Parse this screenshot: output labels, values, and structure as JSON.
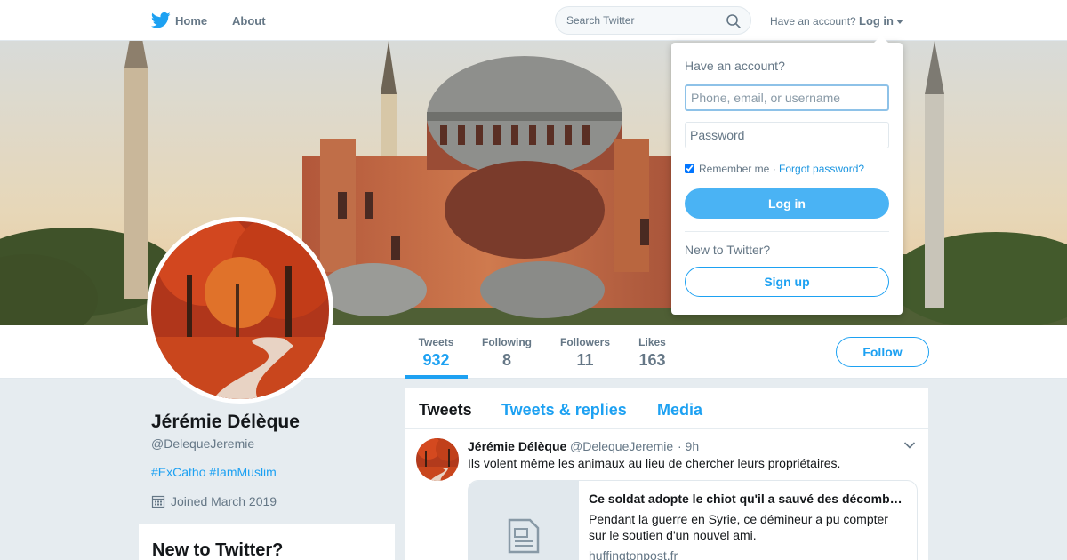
{
  "nav": {
    "home_label": "Home",
    "about_label": "About",
    "search_placeholder": "Search Twitter",
    "have_account": "Have an account?",
    "login_label": "Log in"
  },
  "profile": {
    "name": "Jérémie Délèque",
    "handle": "@DelequeJeremie",
    "bio": "#ExCatho #IamMuslim",
    "joined": "Joined March 2019"
  },
  "stats": [
    {
      "label": "Tweets",
      "value": "932"
    },
    {
      "label": "Following",
      "value": "8"
    },
    {
      "label": "Followers",
      "value": "11"
    },
    {
      "label": "Likes",
      "value": "163"
    }
  ],
  "follow_label": "Follow",
  "sidebar": {
    "signup_heading": "New to Twitter?"
  },
  "timeline": {
    "tabs": [
      "Tweets",
      "Tweets & replies",
      "Media"
    ],
    "tweet": {
      "name": "Jérémie Délèque",
      "handle": "@DelequeJeremie",
      "time": "· 9h",
      "text": "Ils volent même les animaux au lieu de chercher leurs propriétaires.",
      "card": {
        "title": "Ce soldat adopte le chiot qu'il a sauvé des décomb…",
        "description": "Pendant la guerre en Syrie, ce démineur a pu compter sur le soutien d'un nouvel ami.",
        "domain": "huffingtonpost.fr"
      }
    }
  },
  "login_dropdown": {
    "title": "Have an account?",
    "username_placeholder": "Phone, email, or username",
    "password_placeholder": "Password",
    "remember_label": "Remember me ·",
    "forgot_label": "Forgot password?",
    "login_button": "Log in",
    "new_to_twitter": "New to Twitter?",
    "signup_button": "Sign up"
  },
  "colors": {
    "brand_blue": "#1da1f2",
    "login_button": "#4ab3f4",
    "background": "#e6ecf0"
  }
}
